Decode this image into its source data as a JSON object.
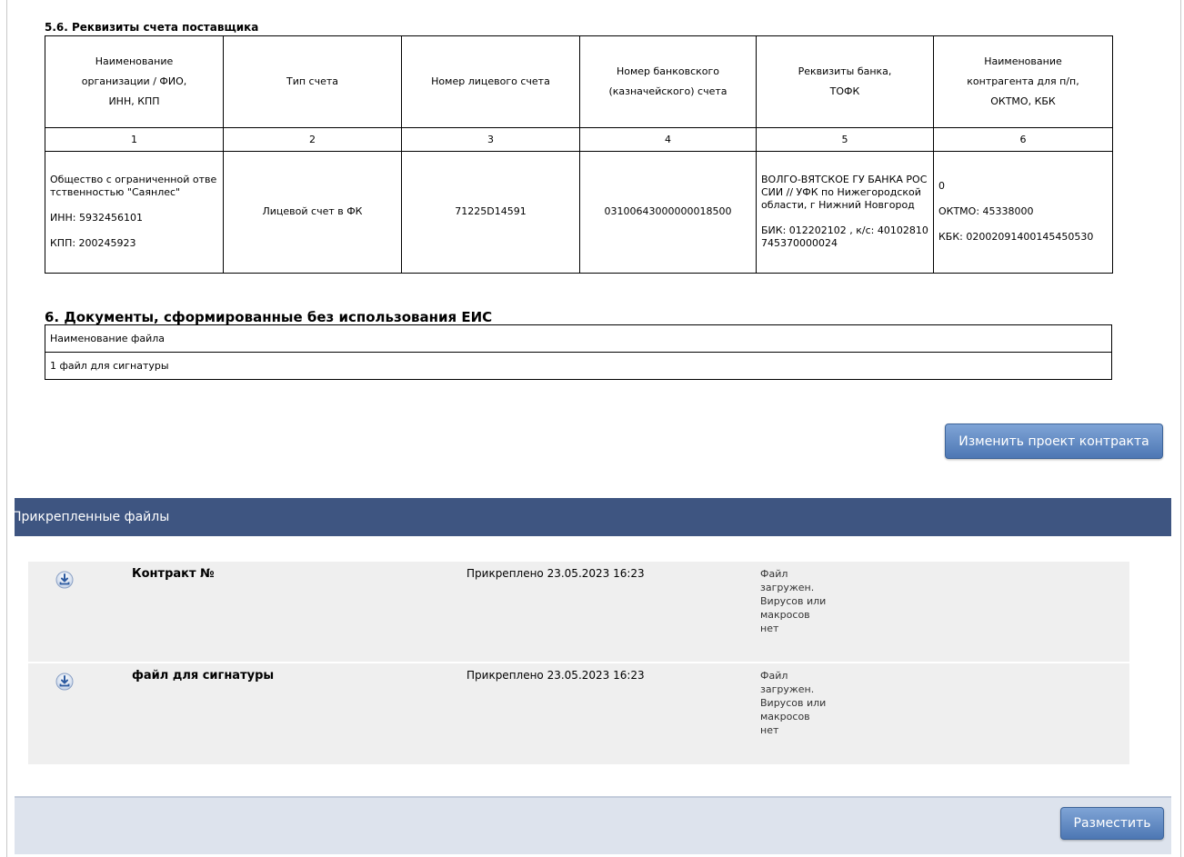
{
  "sections": {
    "account_details_title": "5.6. Реквизиты счета поставщика",
    "documents_title": "6. Документы, сформированные без использования ЕИС"
  },
  "account_table": {
    "headers": [
      [
        "Наименование",
        "организации / ФИО,",
        "ИНН, КПП"
      ],
      [
        "Тип счета"
      ],
      [
        "Номер лицевого счета"
      ],
      [
        "Номер банковского",
        "(казначейского) счета"
      ],
      [
        "Реквизиты банка,",
        "ТОФК"
      ],
      [
        "Наименование",
        "контрагента для п/п,",
        "ОКТМО, КБК"
      ]
    ],
    "numbers": [
      "1",
      "2",
      "3",
      "4",
      "5",
      "6"
    ],
    "row": {
      "org_name": "Общество с ограниченной ответственностью \"Саянлес\"",
      "inn": "ИНН: 5932456101",
      "kpp": "КПП: 200245923",
      "account_type": "Лицевой счет в ФК",
      "personal_account": "71225D14591",
      "bank_account": "03100643000000018500",
      "bank_name": "ВОЛГО-ВЯТСКОЕ ГУ БАНКА РОССИИ // УФК по Нижегородской области, г Нижний Новгород",
      "bank_bik": "БИК: 012202102 , к/с: 40102810745370000024",
      "counterparty": "0",
      "oktmo": "ОКТМО: 45338000",
      "kbk": "КБК: 02002091400145450530"
    }
  },
  "documents_table": {
    "header": "Наименование файла",
    "rows": [
      "1 файл для сигнатуры"
    ]
  },
  "buttons": {
    "change_contract": "Изменить проект контракта",
    "place": "Разместить"
  },
  "attached_files": {
    "title": "Прикрепленные файлы",
    "items": [
      {
        "name": "Контракт №",
        "date": "Прикреплено 23.05.2023 16:23",
        "status": "Файл загружен. Вирусов или макросов нет",
        "icon": "download-icon"
      },
      {
        "name": "файл для сигнатуры",
        "date": "Прикреплено 23.05.2023 16:23",
        "status": "Файл загружен. Вирусов или макросов нет",
        "icon": "download-icon"
      }
    ]
  },
  "colors": {
    "header_bar": "#3e5581",
    "button": "#5b82bd",
    "file_row_bg": "#efefef",
    "bottom_bar": "#dde3ed"
  }
}
